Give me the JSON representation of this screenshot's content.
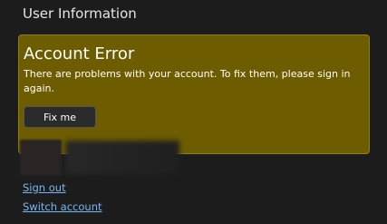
{
  "section": {
    "title": "User Information"
  },
  "error": {
    "title": "Account Error",
    "message": "There are problems with your account. To fix them, please sign in again.",
    "button_label": "Fix me",
    "background_color": "#6d5d00"
  },
  "account": {
    "links": {
      "sign_out": "Sign out",
      "switch_account": "Switch account"
    },
    "link_color": "#78b7f0"
  }
}
